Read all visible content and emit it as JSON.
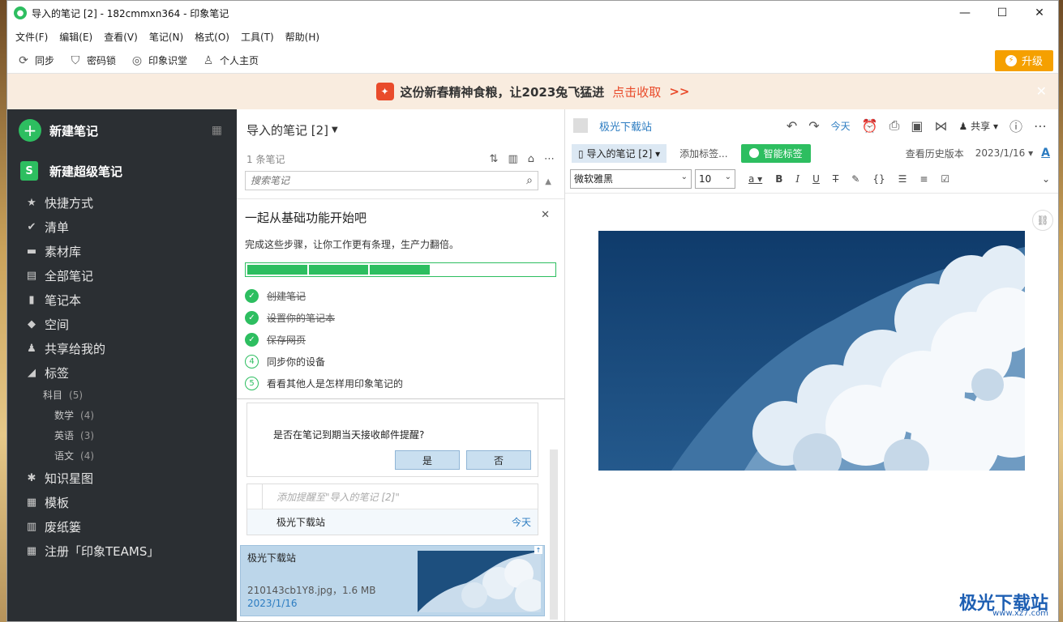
{
  "window": {
    "title": "导入的笔记 [2] - 182cmmxn364 - 印象笔记"
  },
  "menu": [
    "文件(F)",
    "编辑(E)",
    "查看(V)",
    "笔记(N)",
    "格式(O)",
    "工具(T)",
    "帮助(H)"
  ],
  "toolbar": {
    "sync": "同步",
    "lock": "密码锁",
    "knowledge": "印象识堂",
    "profile": "个人主页",
    "upgrade": "升级"
  },
  "promo": {
    "text": "这份新春精神食粮，让2023兔飞猛进",
    "cta": "点击收取",
    "arrows": ">>"
  },
  "sidebar": {
    "new_note": "新建笔记",
    "new_super_note": "新建超级笔记",
    "items": [
      {
        "icon": "star-icon",
        "glyph": "★",
        "label": "快捷方式"
      },
      {
        "icon": "checklist-icon",
        "glyph": "✔",
        "label": "清单"
      },
      {
        "icon": "library-icon",
        "glyph": "▬",
        "label": "素材库"
      },
      {
        "icon": "notes-icon",
        "glyph": "▤",
        "label": "全部笔记"
      },
      {
        "icon": "notebook-icon",
        "glyph": "▮",
        "label": "笔记本"
      },
      {
        "icon": "space-icon",
        "glyph": "◆",
        "label": "空间"
      },
      {
        "icon": "shared-icon",
        "glyph": "♟",
        "label": "共享给我的"
      },
      {
        "icon": "tag-icon",
        "glyph": "◢",
        "label": "标签"
      }
    ],
    "tags": {
      "parent": {
        "label": "科目",
        "count": "(5)"
      },
      "children": [
        {
          "label": "数学",
          "count": "(4)"
        },
        {
          "label": "英语",
          "count": "(3)"
        },
        {
          "label": "语文",
          "count": "(4)"
        }
      ]
    },
    "items_after": [
      {
        "icon": "mindmap-icon",
        "glyph": "✱",
        "label": "知识星图"
      },
      {
        "icon": "template-icon",
        "glyph": "▦",
        "label": "模板"
      },
      {
        "icon": "trash-icon",
        "glyph": "▥",
        "label": "废纸篓"
      },
      {
        "icon": "teams-icon",
        "glyph": "▦",
        "label": "注册「印象TEAMS」"
      }
    ]
  },
  "notelist": {
    "header": "导入的笔记 [2]",
    "count": "1 条笔记",
    "search_placeholder": "搜索笔记",
    "onboarding": {
      "title": "一起从基础功能开始吧",
      "desc": "完成这些步骤，让你工作更有条理，生产力翻倍。",
      "progress": 0.6,
      "steps": [
        {
          "num": "✓",
          "label": "创建笔记",
          "done": true
        },
        {
          "num": "✓",
          "label": "设置你的笔记本",
          "done": true
        },
        {
          "num": "✓",
          "label": "保存网页",
          "done": true
        },
        {
          "num": "4",
          "label": "同步你的设备",
          "done": false
        },
        {
          "num": "5",
          "label": "看看其他人是怎样用印象笔记的",
          "done": false
        }
      ]
    },
    "reminder": {
      "question": "是否在笔记到期当天接收邮件提醒?",
      "yes": "是",
      "no": "否"
    },
    "add_reminder": "添加提醒至\"导入的笔记 [2]\"",
    "reminder_note": {
      "title": "极光下载站",
      "when": "今天"
    },
    "card": {
      "title": "极光下载站",
      "meta": "210143cb1Y8.jpg，1.6 MB",
      "date": "2023/1/16"
    }
  },
  "editor": {
    "note_title": "极光下载站",
    "today": "今天",
    "share": "共享",
    "notebook": "导入的笔记 [2]",
    "add_tag": "添加标签...",
    "smart_tag": "智能标签",
    "history": "查看历史版本",
    "date": "2023/1/16",
    "font_family": "微软雅黑",
    "font_size": "10"
  },
  "watermark": {
    "text": "极光下载站",
    "url": "www.xz7.com"
  }
}
